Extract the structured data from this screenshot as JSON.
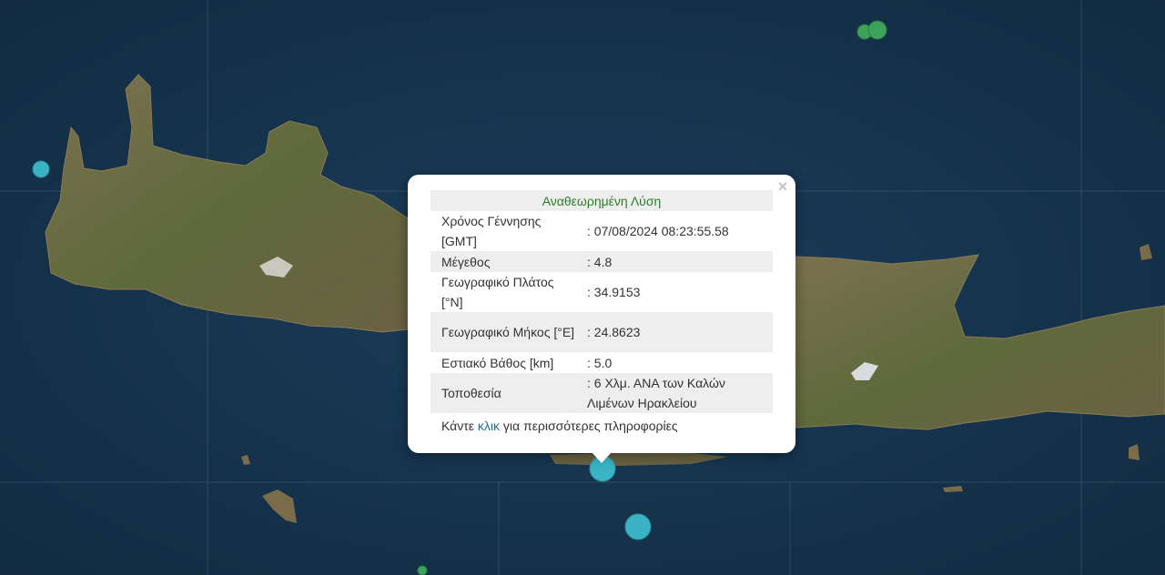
{
  "popup": {
    "title": "Αναθεωρημένη Λύση",
    "close_symbol": "×",
    "rows": [
      {
        "label": "Χρόνος Γέννησης [GMT]",
        "value": ": 07/08/2024 08:23:55.58"
      },
      {
        "label": "Μέγεθος",
        "value": ": 4.8"
      },
      {
        "label": "Γεωγραφικό Πλάτος [°N]",
        "value": ": 34.9153"
      },
      {
        "label": "Γεωγραφικό Μήκος [°E]",
        "value": ": 24.8623"
      },
      {
        "label": "Εστιακό Βάθος [km]",
        "value": ": 5.0"
      },
      {
        "label": "Τοποθεσία",
        "value": ": 6 Χλμ. ΑΝΑ των Καλών Λιμένων Ηρακλείου"
      }
    ],
    "footer_prefix": "Κάντε ",
    "footer_link": "κλικ",
    "footer_suffix": " για περισσότερες πληροφορίες"
  },
  "map": {
    "sea_color": "#163550",
    "land_color": "#6f6a45",
    "marker_colors": {
      "cyan": "#3ab4c4",
      "green": "#3da35a"
    }
  }
}
